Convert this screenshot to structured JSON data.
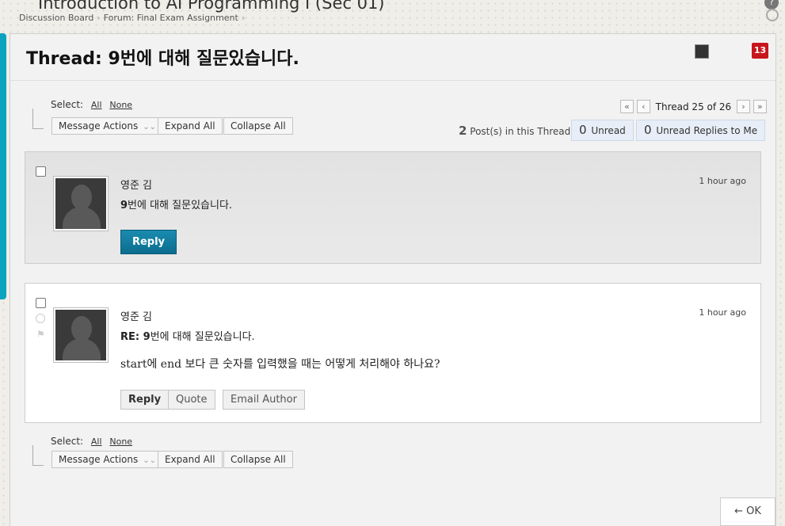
{
  "header": {
    "course_title": "Introduction to AI Programming Ⅰ (Sec 01)",
    "breadcrumb": [
      "Discussion Board",
      "Forum: Final Exam Assignment"
    ]
  },
  "thread": {
    "title": "Thread: 9번에 대해 질문있습니다.",
    "notification_count": "13"
  },
  "toolbar": {
    "select_label": "Select:",
    "all_label": "All",
    "none_label": "None",
    "message_actions_label": "Message Actions",
    "expand_all_label": "Expand All",
    "collapse_all_label": "Collapse All"
  },
  "pager": {
    "text": "Thread 25 of 26",
    "first_icon": "double-chevron-left-icon",
    "prev_icon": "chevron-left-icon",
    "next_icon": "chevron-right-icon",
    "last_icon": "double-chevron-right-icon"
  },
  "stats": {
    "post_count": "2",
    "posts_label": "Post(s) in this Thread",
    "unread_count": "0",
    "unread_label": "Unread",
    "unread_replies_count": "0",
    "unread_replies_label": "Unread Replies to Me"
  },
  "posts": [
    {
      "author": "영준 김",
      "subject_prefix": "9",
      "subject_rest": "번에 대해 질문있습니다.",
      "time": "1 hour ago",
      "reply_label": "Reply"
    },
    {
      "author": "영준 김",
      "subject_prefix": "RE: 9",
      "subject_rest": "번에 대해 질문있습니다.",
      "body": "start에 end 보다 큰 숫자를 입력했을 때는 어떻게 처리해야 하나요?",
      "time": "1 hour ago",
      "reply_label": "Reply",
      "quote_label": "Quote",
      "email_author_label": "Email Author"
    }
  ],
  "footer": {
    "ok_label": "← OK"
  },
  "colors": {
    "accent_bar": "#0ba4bf",
    "reply_button": "#0b6d8e",
    "badge": "#c8161d"
  }
}
